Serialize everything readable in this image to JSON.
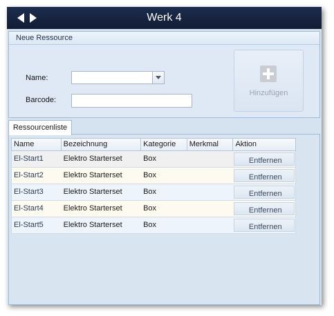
{
  "window": {
    "title": "Werk 4"
  },
  "form": {
    "group_title": "Neue Ressource",
    "name_label": "Name:",
    "name_value": "",
    "barcode_label": "Barcode:",
    "barcode_value": "",
    "add_label": "Hinzufügen"
  },
  "tab": {
    "label": "Ressourcenliste"
  },
  "grid": {
    "columns": [
      "Name",
      "Bezeichnung",
      "Kategorie",
      "Merkmal",
      "Aktion"
    ],
    "rows": [
      {
        "name": "El-Start1",
        "bezeichnung": "Elektro Starterset",
        "kategorie": "Box",
        "merkmal": "",
        "aktion": "Entfernen"
      },
      {
        "name": "El-Start2",
        "bezeichnung": "Elektro Starterset",
        "kategorie": "Box",
        "merkmal": "",
        "aktion": "Entfernen"
      },
      {
        "name": "El-Start3",
        "bezeichnung": "Elektro Starterset",
        "kategorie": "Box",
        "merkmal": "",
        "aktion": "Entfernen"
      },
      {
        "name": "El-Start4",
        "bezeichnung": "Elektro Starterset",
        "kategorie": "Box",
        "merkmal": "",
        "aktion": "Entfernen"
      },
      {
        "name": "El-Start5",
        "bezeichnung": "Elektro Starterset",
        "kategorie": "Box",
        "merkmal": "",
        "aktion": "Entfernen"
      }
    ]
  },
  "icons": {
    "back": "arrow-left-icon",
    "forward": "arrow-right-icon",
    "dropdown": "chevron-down-icon",
    "add": "plus-icon"
  },
  "colors": {
    "titlebar": "#1d2d4f",
    "panel": "#d5e3f1"
  }
}
